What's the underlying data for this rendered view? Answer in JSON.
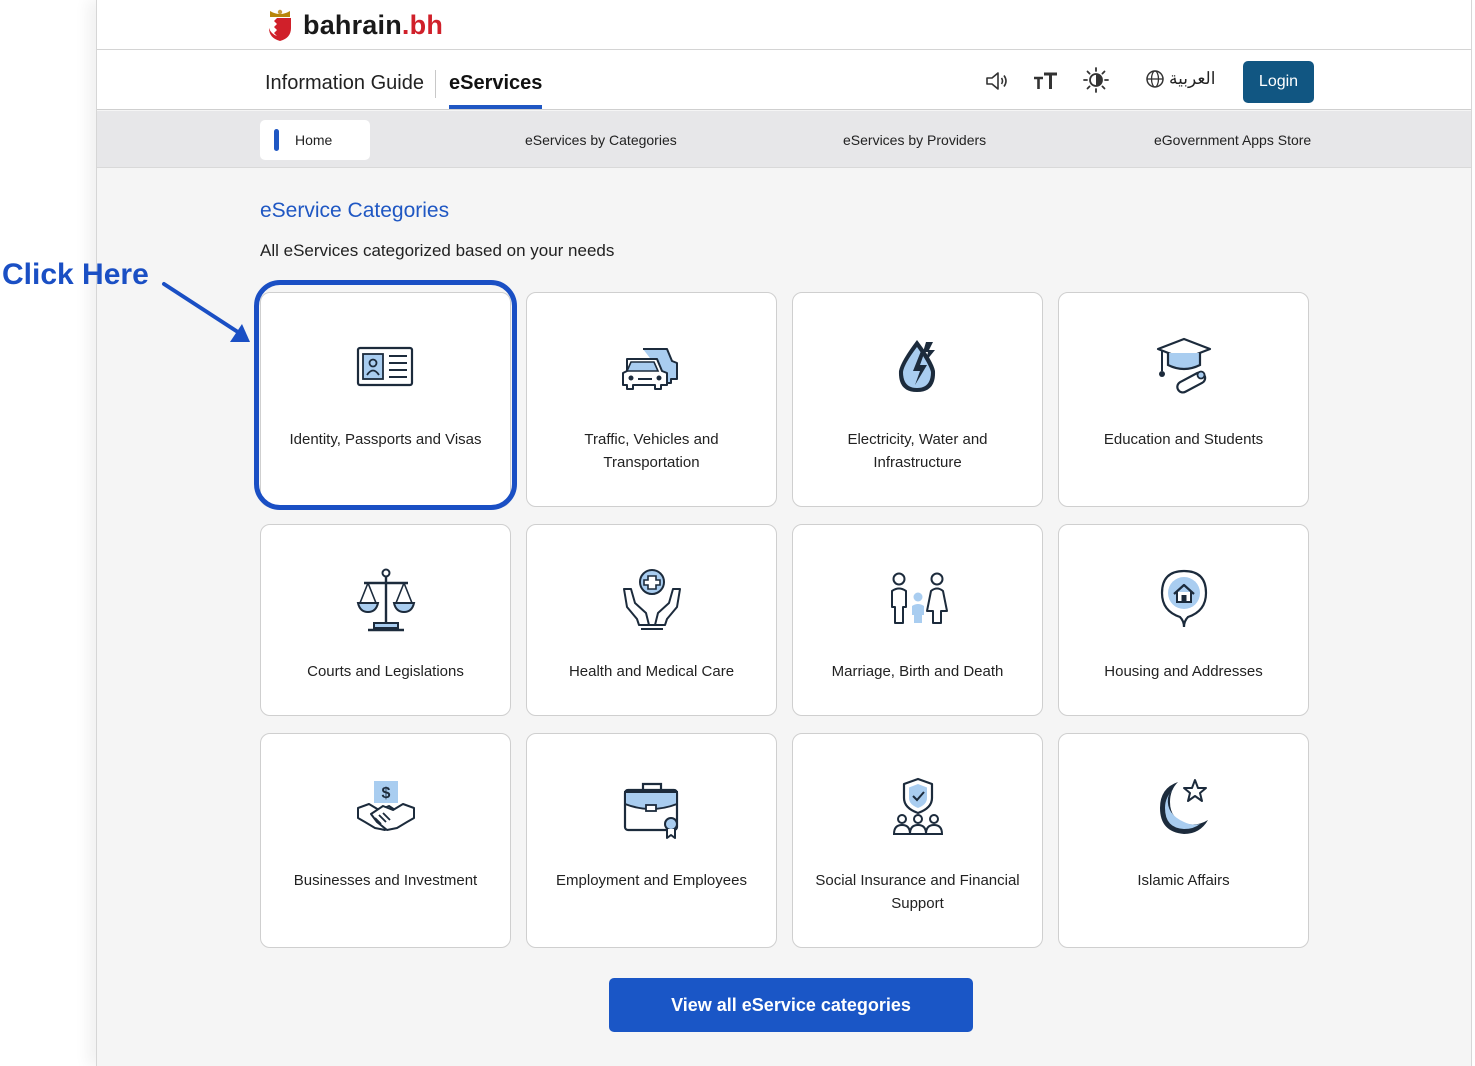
{
  "header": {
    "logo_text_main": "bahrain",
    "logo_text_domain": ".bh",
    "tabs": [
      {
        "label": "Information Guide"
      },
      {
        "label": "eServices",
        "active": true
      }
    ],
    "tools": [
      {
        "icon": "speaker-icon"
      },
      {
        "icon": "text-size-icon"
      },
      {
        "icon": "contrast-icon"
      }
    ],
    "language_label": "العربية",
    "login_label": "Login"
  },
  "subnav": {
    "items": [
      {
        "label": "Home",
        "active": true
      },
      {
        "label": "eServices by Categories"
      },
      {
        "label": "eServices by Providers"
      },
      {
        "label": "eGovernment Apps Store"
      }
    ]
  },
  "main": {
    "title": "eService Categories",
    "subtitle": "All eServices categorized based on your needs",
    "categories": [
      {
        "label": "Identity, Passports and Visas",
        "icon": "id-card-icon"
      },
      {
        "label": "Traffic, Vehicles and Transportation",
        "icon": "cars-icon"
      },
      {
        "label": "Electricity, Water and Infrastructure",
        "icon": "water-electricity-icon"
      },
      {
        "label": "Education and Students",
        "icon": "graduation-cap-icon"
      },
      {
        "label": "Courts and Legislations",
        "icon": "scales-icon"
      },
      {
        "label": "Health and Medical Care",
        "icon": "hands-medical-icon"
      },
      {
        "label": "Marriage, Birth and Death",
        "icon": "family-icon"
      },
      {
        "label": "Housing and Addresses",
        "icon": "house-pin-icon"
      },
      {
        "label": "Businesses and Investment",
        "icon": "handshake-dollar-icon"
      },
      {
        "label": "Employment and Employees",
        "icon": "briefcase-icon"
      },
      {
        "label": "Social Insurance and Financial Support",
        "icon": "shield-people-icon"
      },
      {
        "label": "Islamic Affairs",
        "icon": "crescent-star-icon"
      }
    ],
    "view_all_label": "View all eService categories"
  },
  "annotation": {
    "callout_text": "Click Here"
  },
  "colors": {
    "accent": "#1f57c3",
    "login_bg": "#115682",
    "logo_red": "#d0202a",
    "annotation_blue": "#1a4fc4"
  }
}
